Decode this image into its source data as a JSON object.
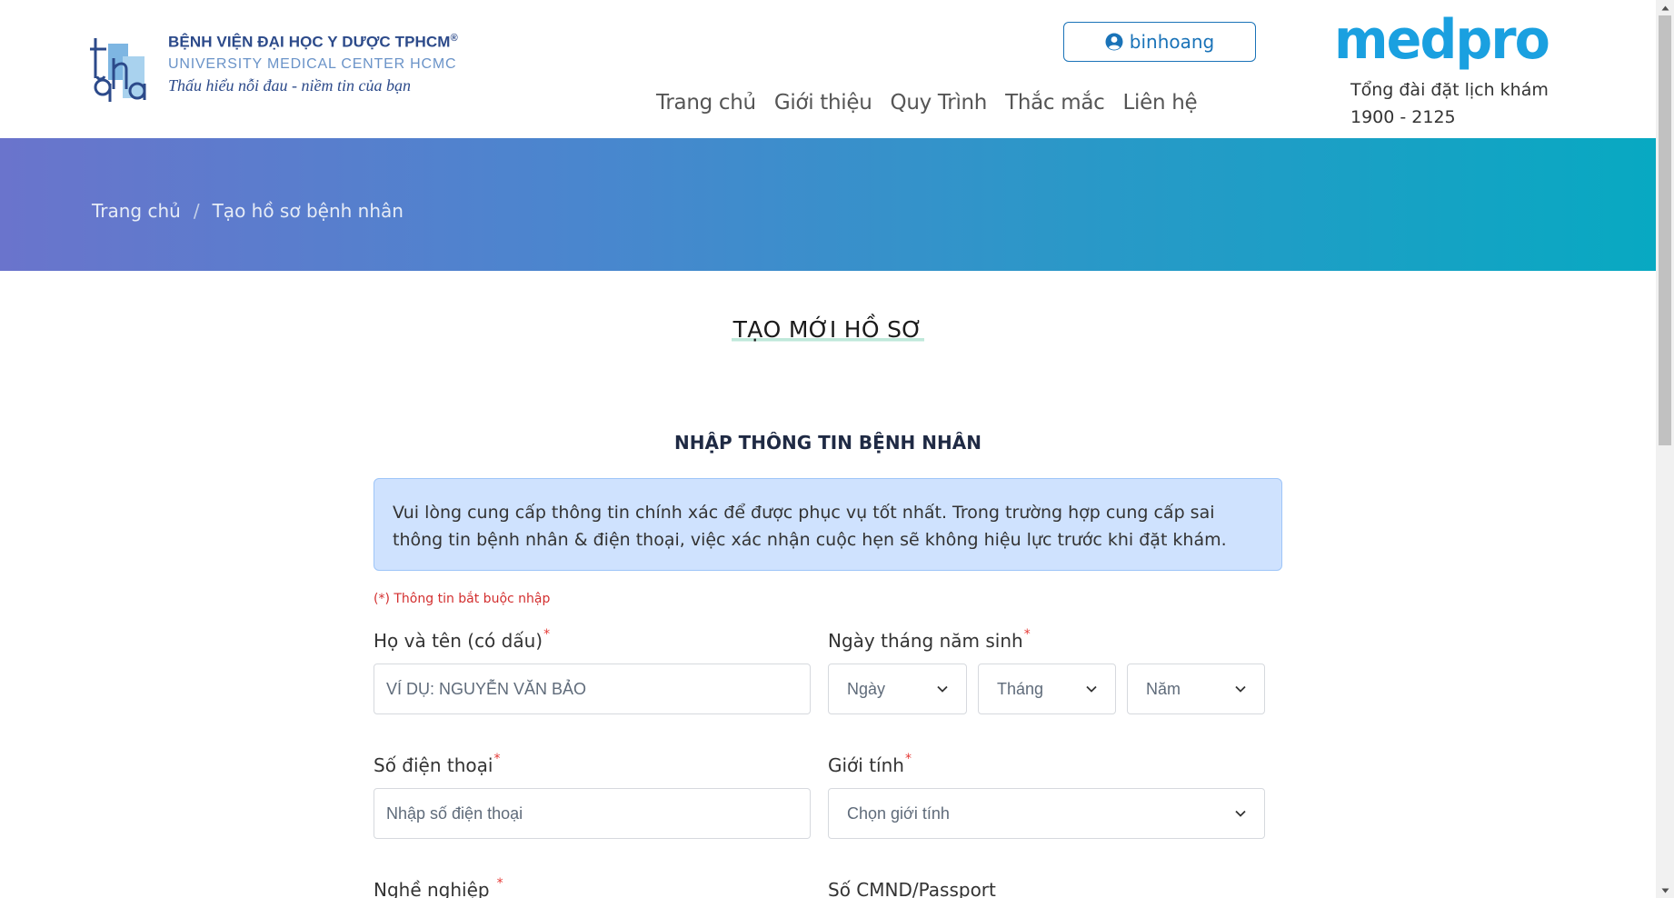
{
  "header": {
    "hospital_name": "BỆNH VIỆN ĐẠI HỌC Y DƯỢC TPHCM",
    "hospital_name_mark": "®",
    "hospital_name_en": "UNIVERSITY MEDICAL CENTER HCMC",
    "hospital_slogan": "Thấu hiểu nỗi đau - niềm tin của bạn",
    "user_label": "binhoang",
    "nav": [
      {
        "label": "Trang chủ"
      },
      {
        "label": "Giới thiệu"
      },
      {
        "label": "Quy Trình"
      },
      {
        "label": "Thắc mắc"
      },
      {
        "label": "Liên hệ"
      }
    ],
    "brand": "medpro",
    "hotline_label": "Tổng đài đặt lịch khám",
    "hotline_number": "1900 - 2125"
  },
  "breadcrumb": {
    "home": "Trang chủ",
    "separator": "/",
    "current": "Tạo hồ sơ bệnh nhân"
  },
  "main": {
    "title": "TẠO MỚI HỒ SƠ",
    "section_title": "NHẬP THÔNG TIN BỆNH NHÂN",
    "notice": "Vui lòng cung cấp thông tin chính xác để được phục vụ tốt nhất. Trong trường hợp cung cấp sai thông tin bệnh nhân & điện thoại, việc xác nhận cuộc hẹn sẽ không hiệu lực trước khi đặt khám.",
    "required_note": "(*) Thông tin bắt buộc nhập"
  },
  "form": {
    "name": {
      "label": "Họ và tên (có dấu)",
      "placeholder": "VÍ DỤ: NGUYỄN VĂN BẢO"
    },
    "dob": {
      "label": "Ngày tháng năm sinh",
      "day": "Ngày",
      "month": "Tháng",
      "year": "Năm"
    },
    "phone": {
      "label": "Số điện thoại",
      "placeholder": "Nhập số điện thoại"
    },
    "gender": {
      "label": "Giới tính",
      "placeholder": "Chọn giới tính"
    },
    "job": {
      "label": "Nghề nghiệp"
    },
    "id_card": {
      "label": "Số CMND/Passport"
    },
    "required_mark": "*"
  },
  "colors": {
    "primary": "#1a73b8",
    "brand": "#1aa0e0",
    "banner_start": "#6a74cc",
    "banner_end": "#08a9c2",
    "notice_bg": "#cfe2fe",
    "required": "#e53935"
  }
}
